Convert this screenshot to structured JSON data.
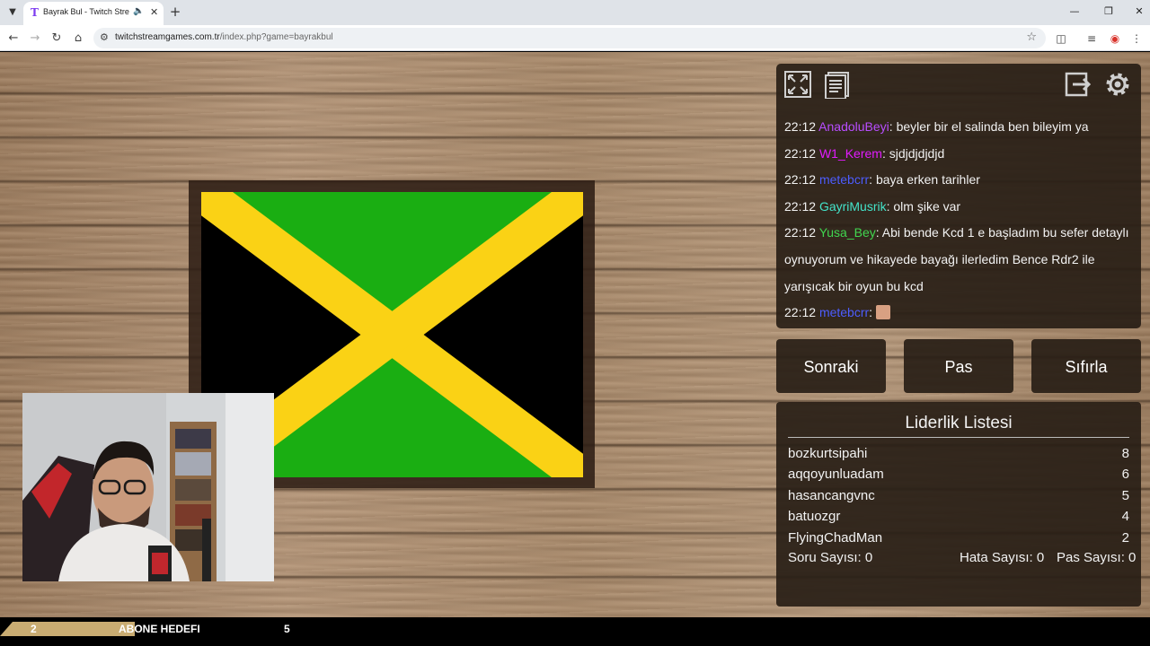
{
  "browser": {
    "tab_title": "Bayrak Bul - Twitch Stream Games",
    "tab_favicon": "T",
    "url_domain": "twitchstreamgames.com.tr",
    "url_path": "/index.php?game=bayrakbul"
  },
  "chat": {
    "messages": [
      {
        "time": "22:12",
        "user": "AnadoluBeyi",
        "color": "#b84dff",
        "text": ": beyler bir el salinda ben bileyim ya"
      },
      {
        "time": "22:12",
        "user": "W1_Kerem",
        "color": "#e21bff",
        "text": ": sjdjdjdjdjd"
      },
      {
        "time": "22:12",
        "user": "metebcrr",
        "color": "#4d5dff",
        "text": ": baya erken tarihler"
      },
      {
        "time": "22:12",
        "user": "GayriMusrik",
        "color": "#43e3c9",
        "text": ": olm şike var"
      },
      {
        "time": "22:12",
        "user": "Yusa_Bey",
        "color": "#41d64f",
        "text": ": Abi bende Kcd 1 e başladım bu sefer detaylı oynuyorum ve hikayede bayağı ilerledim Bence Rdr2 ile yarışıcak bir oyun bu kcd"
      },
      {
        "time": "22:12",
        "user": "metebcrr",
        "color": "#4d5dff",
        "text": ":",
        "emote": true
      }
    ]
  },
  "buttons": {
    "next": "Sonraki",
    "pass": "Pas",
    "reset": "Sıfırla"
  },
  "leaderboard": {
    "title": "Liderlik Listesi",
    "rows": [
      {
        "name": "bozkurtsipahi",
        "score": "8"
      },
      {
        "name": "aqqoyunluadam",
        "score": "6"
      },
      {
        "name": "hasancangvnc",
        "score": "5"
      },
      {
        "name": "batuozgr",
        "score": "4"
      },
      {
        "name": "FlyingChadMan",
        "score": "2"
      }
    ],
    "stats": {
      "questions": "Soru Sayısı: 0",
      "errors": "Hata Sayısı: 0",
      "passes": "Pas Sayısı: 0"
    }
  },
  "goal": {
    "current": "2",
    "label": "ABONE HEDEFI",
    "target": "5",
    "progress": 0.4
  },
  "colors": {
    "flag_green": "#1aae12",
    "flag_yellow": "#fad215",
    "flag_black": "#000000",
    "panel": "#281e16"
  }
}
